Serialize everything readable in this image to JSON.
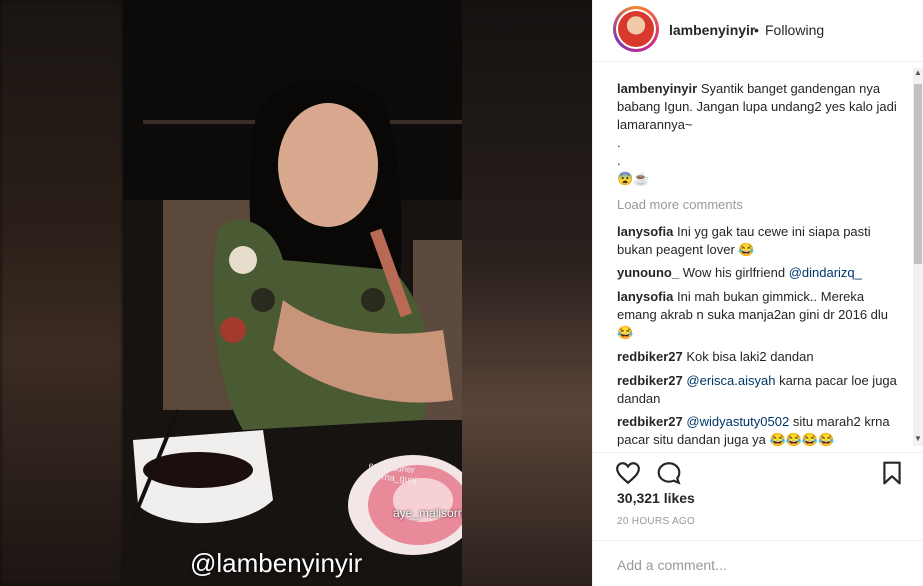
{
  "post": {
    "username": "lambenyinyir",
    "separator": "•",
    "follow_status": "Following",
    "caption_user": "lambenyinyir",
    "caption_text": "Syantik banget gandengan nya babang Igun. Jangan lupa undang2 yes kalo jadi lamarannya~",
    "caption_dot1": ".",
    "caption_dot2": ".",
    "caption_emoji": "😨☕",
    "load_more": "Load more comments",
    "likes": "30,321 likes",
    "timestamp": "20 HOURS AGO",
    "add_comment_placeholder": "Add a comment..."
  },
  "comments": [
    {
      "user": "lanysofia",
      "text": "Ini yg gak tau cewe ini siapa pasti bukan peagent lover 😂"
    },
    {
      "user": "yunouno_",
      "text": "Wow his girlfriend ",
      "mention": "@dindarizq_"
    },
    {
      "user": "lanysofia",
      "text": "Ini mah bukan gimmick.. Mereka emang akrab n suka manja2an gini dr 2016 dlu 😂"
    },
    {
      "user": "redbiker27",
      "text": "Kok bisa laki2 dandan"
    },
    {
      "user": "redbiker27",
      "mention": "@erisca.aisyah",
      "text": " karna pacar loe juga dandan"
    },
    {
      "user": "redbiker27",
      "mention": "@widyastuty0502",
      "text": " situ marah2 krna pacar situ dandan juga ya 😂😂😂😂"
    }
  ],
  "media": {
    "watermark": "@lambenyinyir",
    "tag_small": "enjay.aurier @erna_gunj",
    "tag_user": "aye_malisorn"
  },
  "icons": {
    "like": "heart-icon",
    "comment": "speech-bubble-icon",
    "save": "bookmark-icon"
  },
  "colors": {
    "text": "#262626",
    "muted": "#999999",
    "mention": "#003569",
    "border": "#efefef"
  }
}
